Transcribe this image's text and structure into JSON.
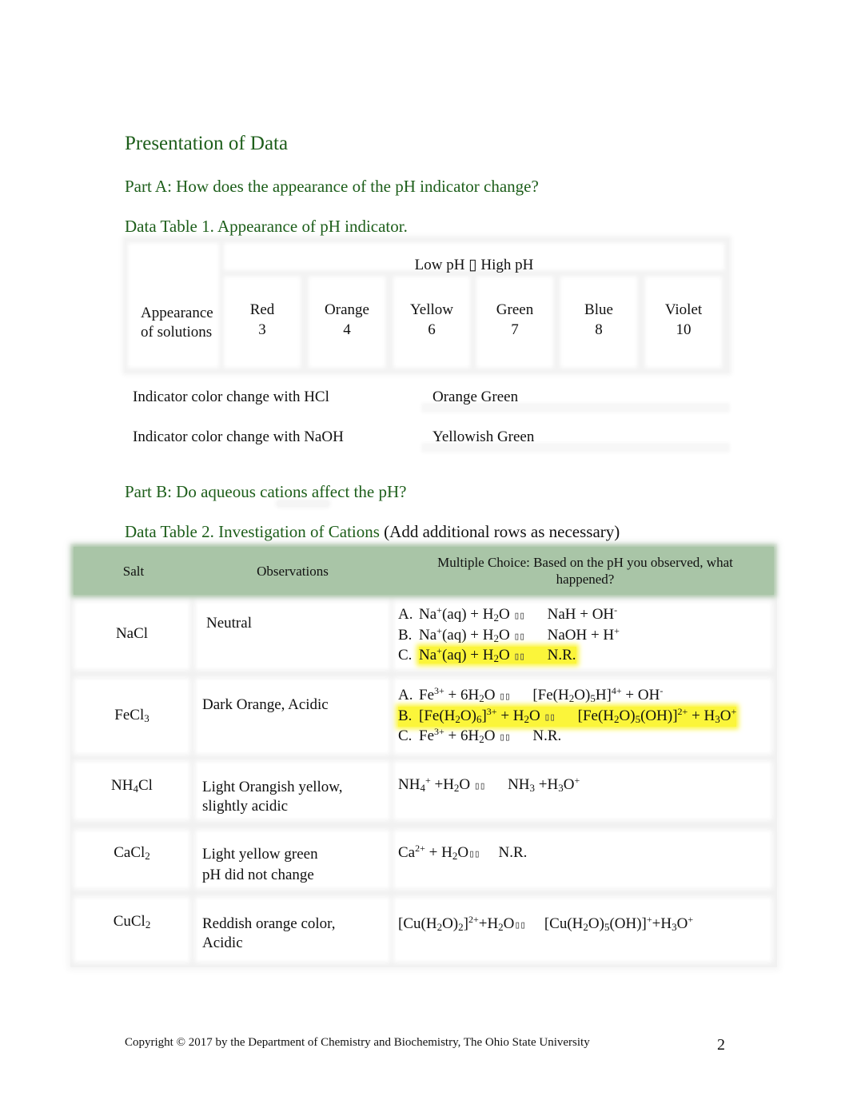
{
  "headings": {
    "presentation": "Presentation of Data",
    "part_a": "Part A: How does the appearance of the pH indicator change?",
    "table1_caption": "Data Table 1.   Appearance of pH indicator.",
    "part_b": "Part B: Do aqueous cations affect the pH?",
    "table2_caption_green": "Data Table 2.   Investigation of Cations ",
    "table2_caption_black": "(Add additional rows as necessary)"
  },
  "table1": {
    "row_label_line1": "Appearance",
    "row_label_line2": "of solutions",
    "range_label": "Low pH ▯   High pH",
    "columns": [
      {
        "color": "Red",
        "ph": "3"
      },
      {
        "color": "Orange",
        "ph": "4"
      },
      {
        "color": "Yellow",
        "ph": "6"
      },
      {
        "color": "Green",
        "ph": "7"
      },
      {
        "color": "Blue",
        "ph": "8"
      },
      {
        "color": "Violet",
        "ph": "10"
      }
    ]
  },
  "indicator_changes": [
    {
      "question": "Indicator color change with HCl",
      "answer": "Orange Green"
    },
    {
      "question": "Indicator color change with NaOH",
      "answer": "Yellowish Green"
    }
  ],
  "table2": {
    "headers": {
      "salt": "Salt",
      "observations": "Observations",
      "choice": "Multiple Choice: Based on the pH you observed, what happened?"
    },
    "arrow_glyph": "▯▯",
    "rows": [
      {
        "salt": "NaCl",
        "observation": "Neutral",
        "highlighted_option": "C"
      },
      {
        "salt": "FeCl3",
        "observation": "Dark Orange, Acidic",
        "highlighted_option": "B"
      },
      {
        "salt": "NH4Cl",
        "observation_line1": "Light Orangish yellow,",
        "observation_line2": "slightly acidic"
      },
      {
        "salt": "CaCl2",
        "observation_line1": "Light yellow green",
        "observation_line2": "pH did not change"
      },
      {
        "salt": "CuCl2",
        "observation_line1": "Reddish orange color,",
        "observation_line2": "Acidic"
      }
    ],
    "options": {
      "nacl": {
        "a_prefix": "A.",
        "a_right": "NaH + OH",
        "b_prefix": "B.",
        "b_right": "NaOH + H",
        "c_prefix": "C.",
        "c_right": "N.R."
      },
      "fecl3": {
        "a_prefix": "A.",
        "b_prefix": "B.",
        "c_prefix": "C.",
        "c_right": "N.R."
      },
      "cacl2_right": "N.R."
    }
  },
  "footer": {
    "copyright": "Copyright © 2017 by the Department of Chemistry and Biochemistry, The Ohio State University",
    "page_number": "2"
  },
  "colors": {
    "heading_green": "#1d5e1a",
    "table_header_green": "#a9c5a7",
    "highlight_yellow": "#fbf53a"
  }
}
